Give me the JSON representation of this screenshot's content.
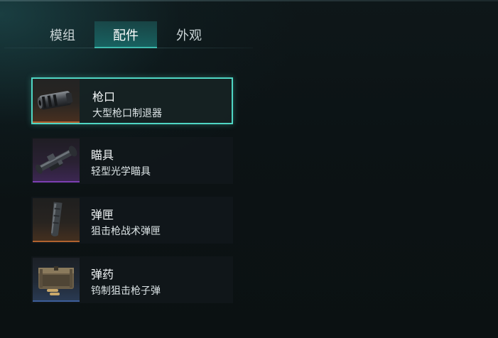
{
  "tabs": [
    {
      "label": "模组",
      "active": false
    },
    {
      "label": "配件",
      "active": true
    },
    {
      "label": "外观",
      "active": false
    }
  ],
  "slots": [
    {
      "category": "枪口",
      "item": "大型枪口制退器",
      "icon": "muzzle-brake-icon",
      "rarity_color": "#b0622f",
      "selected": true
    },
    {
      "category": "瞄具",
      "item": "轻型光学瞄具",
      "icon": "scope-icon",
      "rarity_color": "#7d3fb3",
      "selected": false
    },
    {
      "category": "弹匣",
      "item": "狙击枪战术弹匣",
      "icon": "magazine-icon",
      "rarity_color": "#b0622f",
      "selected": false
    },
    {
      "category": "弹药",
      "item": "钨制狙击枪子弹",
      "icon": "ammo-box-icon",
      "rarity_color": "#3d5e9a",
      "selected": false
    }
  ],
  "colors": {
    "accent": "#4fd6c4",
    "active_tab": "#1f6e6b"
  }
}
